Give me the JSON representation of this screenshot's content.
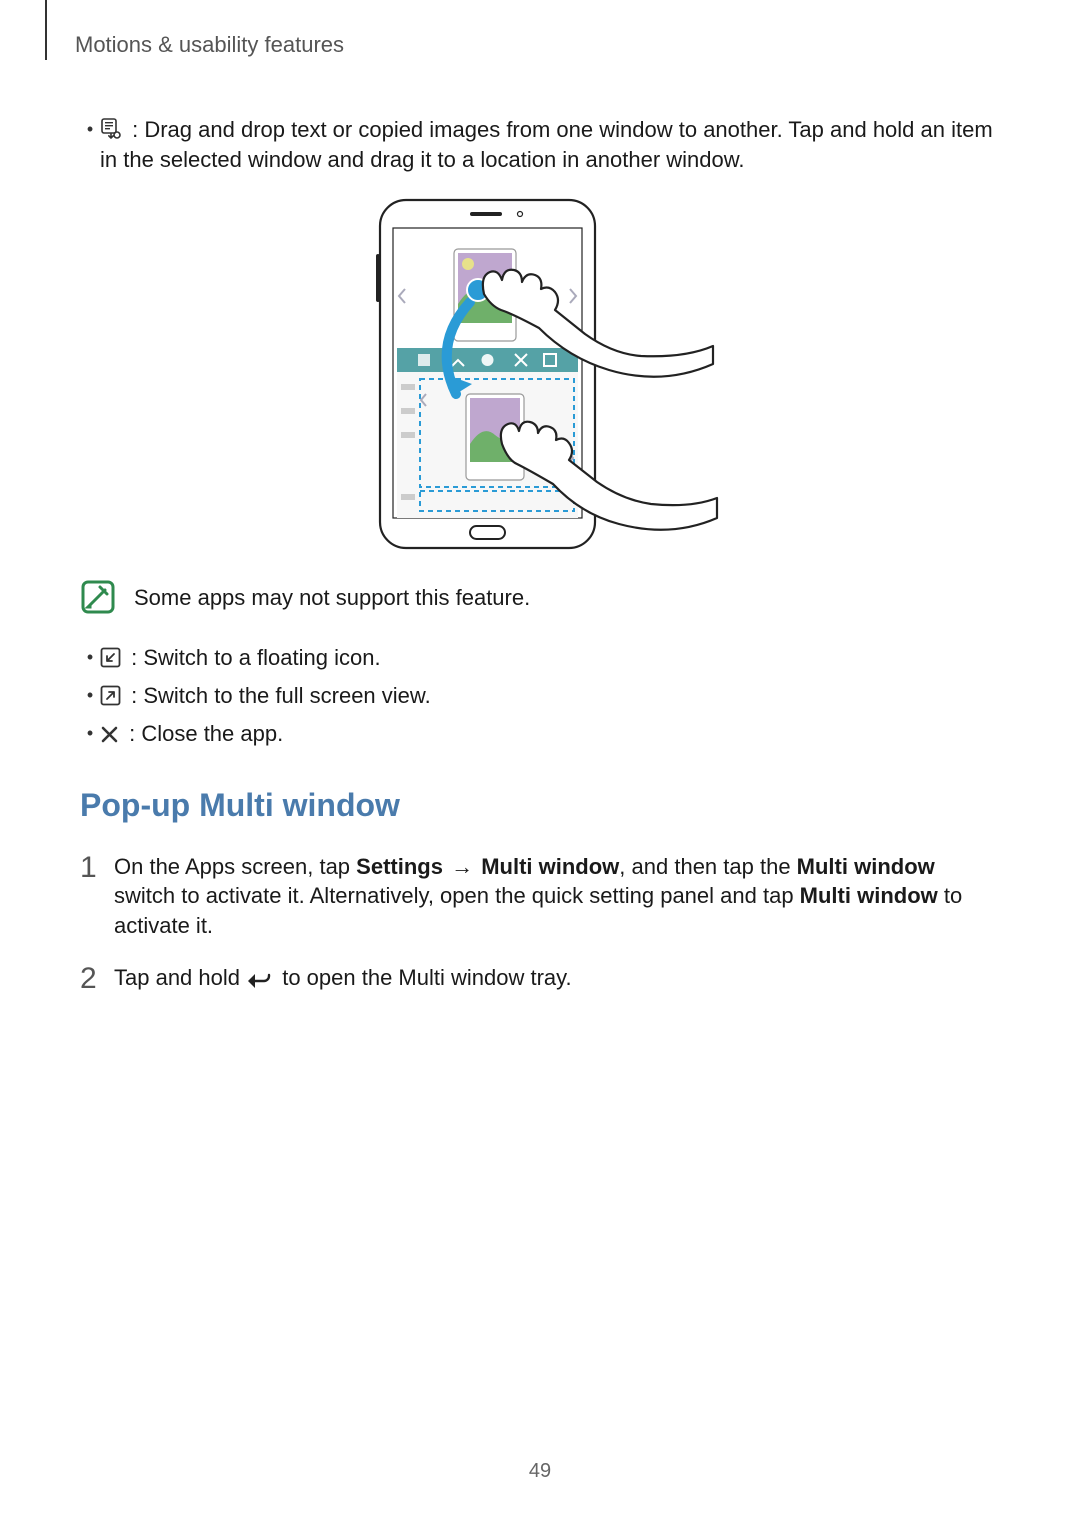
{
  "header": {
    "title": "Motions & usability features"
  },
  "bullets_top": [
    {
      "icon": "drag-content-icon",
      "text": " : Drag and drop text or copied images from one window to another. Tap and hold an item in the selected window and drag it to a location in another window."
    }
  ],
  "note": {
    "text": "Some apps may not support this feature."
  },
  "bullets_mid": [
    {
      "icon": "minimize-icon",
      "text": " : Switch to a floating icon."
    },
    {
      "icon": "fullscreen-icon",
      "text": " : Switch to the full screen view."
    },
    {
      "icon": "close-icon",
      "text": " : Close the app."
    }
  ],
  "heading": "Pop-up Multi window",
  "steps": [
    {
      "num": "1",
      "parts": [
        {
          "t": "text",
          "v": "On the Apps screen, tap "
        },
        {
          "t": "bold",
          "v": "Settings"
        },
        {
          "t": "text",
          "v": " "
        },
        {
          "t": "arrow"
        },
        {
          "t": "text",
          "v": " "
        },
        {
          "t": "bold",
          "v": "Multi window"
        },
        {
          "t": "text",
          "v": ", and then tap the "
        },
        {
          "t": "bold",
          "v": "Multi window"
        },
        {
          "t": "text",
          "v": " switch to activate it. Alternatively, open the quick setting panel and tap "
        },
        {
          "t": "bold",
          "v": "Multi window"
        },
        {
          "t": "text",
          "v": " to activate it."
        }
      ]
    },
    {
      "num": "2",
      "parts": [
        {
          "t": "text",
          "v": "Tap and hold "
        },
        {
          "t": "icon",
          "v": "back-icon"
        },
        {
          "t": "text",
          "v": " to open the Multi window tray."
        }
      ]
    }
  ],
  "page_number": "49",
  "arrow_glyph": "→"
}
